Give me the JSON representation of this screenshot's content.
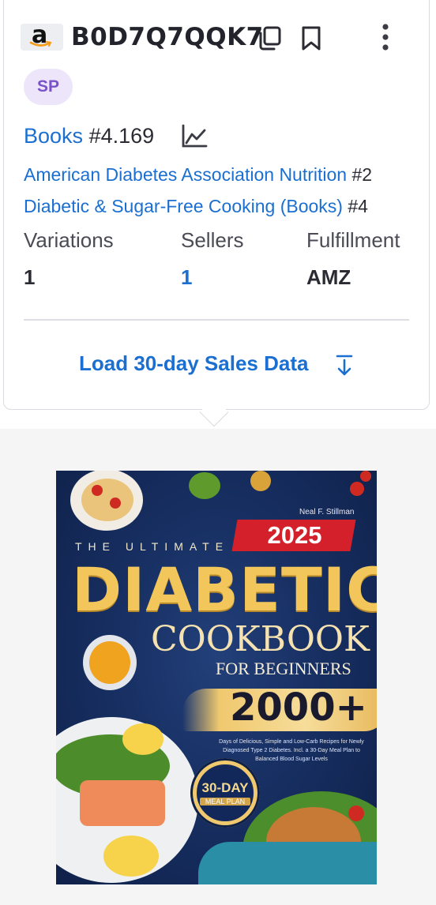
{
  "header": {
    "marketplace_logo": "a",
    "asin": "B0D7Q7QQK7",
    "icons": [
      "copy-icon",
      "bookmark-icon",
      "more-vertical-icon"
    ]
  },
  "badge": {
    "label": "SP"
  },
  "rank": {
    "category": "Books",
    "position": "#4.169",
    "icon": "trend-chart-icon"
  },
  "subranks": [
    {
      "category": "American Diabetes Association Nutrition",
      "position": "#2"
    },
    {
      "category": "Diabetic & Sugar-Free Cooking (Books)",
      "position": "#4"
    }
  ],
  "stats": {
    "variations": {
      "label": "Variations",
      "value": "1"
    },
    "sellers": {
      "label": "Sellers",
      "value": "1"
    },
    "fulfillment": {
      "label": "Fulfillment",
      "value": "AMZ"
    }
  },
  "load_button": {
    "label": "Load 30-day Sales Data",
    "icon": "arrow-down-icon"
  },
  "cover": {
    "author": "Neal F. Stillman",
    "year": "2025",
    "line1": "THE ULTIMATE",
    "line2": "DIABETIC",
    "line3": "COOKBOOK",
    "line4": "FOR BEGINNERS",
    "count": "2000+",
    "description": "Days of Delicious, Simple and Low-Carb Recipes for Newly Diagnosed Type 2 Diabetes. Incl. a 30-Day Meal Plan to Balanced Blood Sugar Levels",
    "seal_line1": "30-DAY",
    "seal_line2": "MEAL PLAN"
  },
  "colors": {
    "link": "#1a6fd1",
    "badge_bg": "#ede6fa",
    "badge_text": "#7a52c9",
    "cover_bg": "#172f62",
    "cover_gold": "#f2c65b",
    "cover_red": "#d3202a"
  }
}
